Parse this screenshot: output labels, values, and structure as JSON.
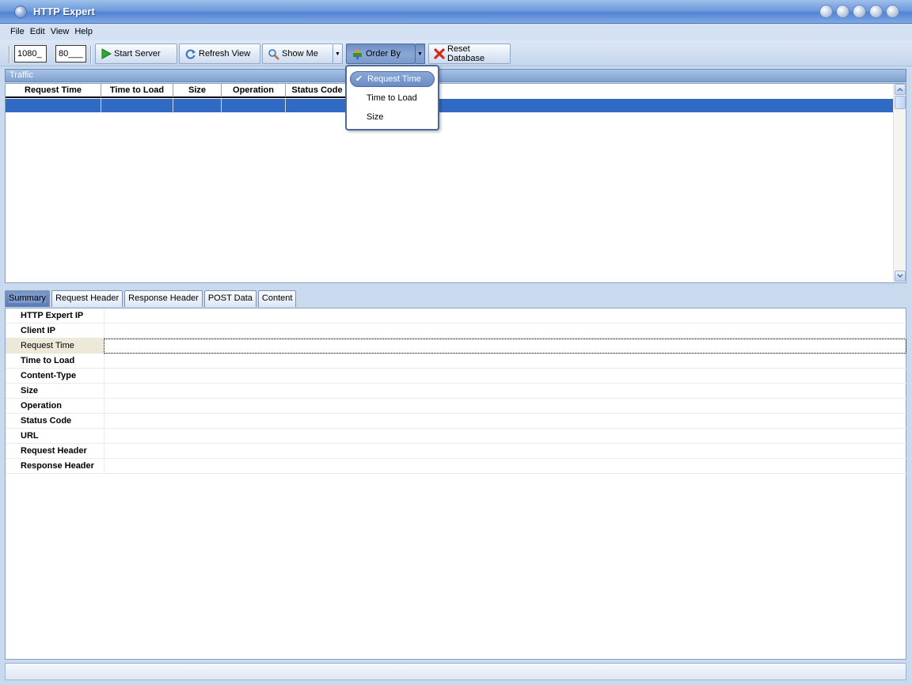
{
  "window": {
    "title": "HTTP Expert"
  },
  "menu": [
    "File",
    "Edit",
    "View",
    "Help"
  ],
  "toolbar": {
    "port_primary": "1080_",
    "port_secondary": "80___",
    "start_server": "Start Server",
    "refresh_view": "Refresh View",
    "show_me": "Show Me",
    "order_by": "Order By",
    "reset_database": "Reset Database"
  },
  "traffic": {
    "title": "Traffic",
    "columns": [
      "Request Time",
      "Time to Load",
      "Size",
      "Operation",
      "Status Code"
    ]
  },
  "order_by_menu": {
    "items": [
      "Request Time",
      "Time to Load",
      "Size"
    ],
    "checked": "Request Time"
  },
  "tabs": [
    "Summary",
    "Request Header",
    "Response Header",
    "POST Data",
    "Content"
  ],
  "active_tab": "Summary",
  "summary": {
    "rows": [
      {
        "label": "HTTP Expert IP",
        "value": ""
      },
      {
        "label": "Client IP",
        "value": ""
      },
      {
        "label": "Request Time",
        "value": ""
      },
      {
        "label": "Time to Load",
        "value": ""
      },
      {
        "label": "Content-Type",
        "value": ""
      },
      {
        "label": "Size",
        "value": ""
      },
      {
        "label": "Operation",
        "value": ""
      },
      {
        "label": "Status Code",
        "value": ""
      },
      {
        "label": "URL",
        "value": ""
      },
      {
        "label": "Request Header",
        "value": ""
      },
      {
        "label": "Response Header",
        "value": ""
      }
    ],
    "selected_row": "Request Time"
  },
  "status_bar": {
    "text": ""
  },
  "colors": {
    "selection": "#316ac5",
    "title_gradient": "#5284d2",
    "background": "#c9d9ee"
  }
}
